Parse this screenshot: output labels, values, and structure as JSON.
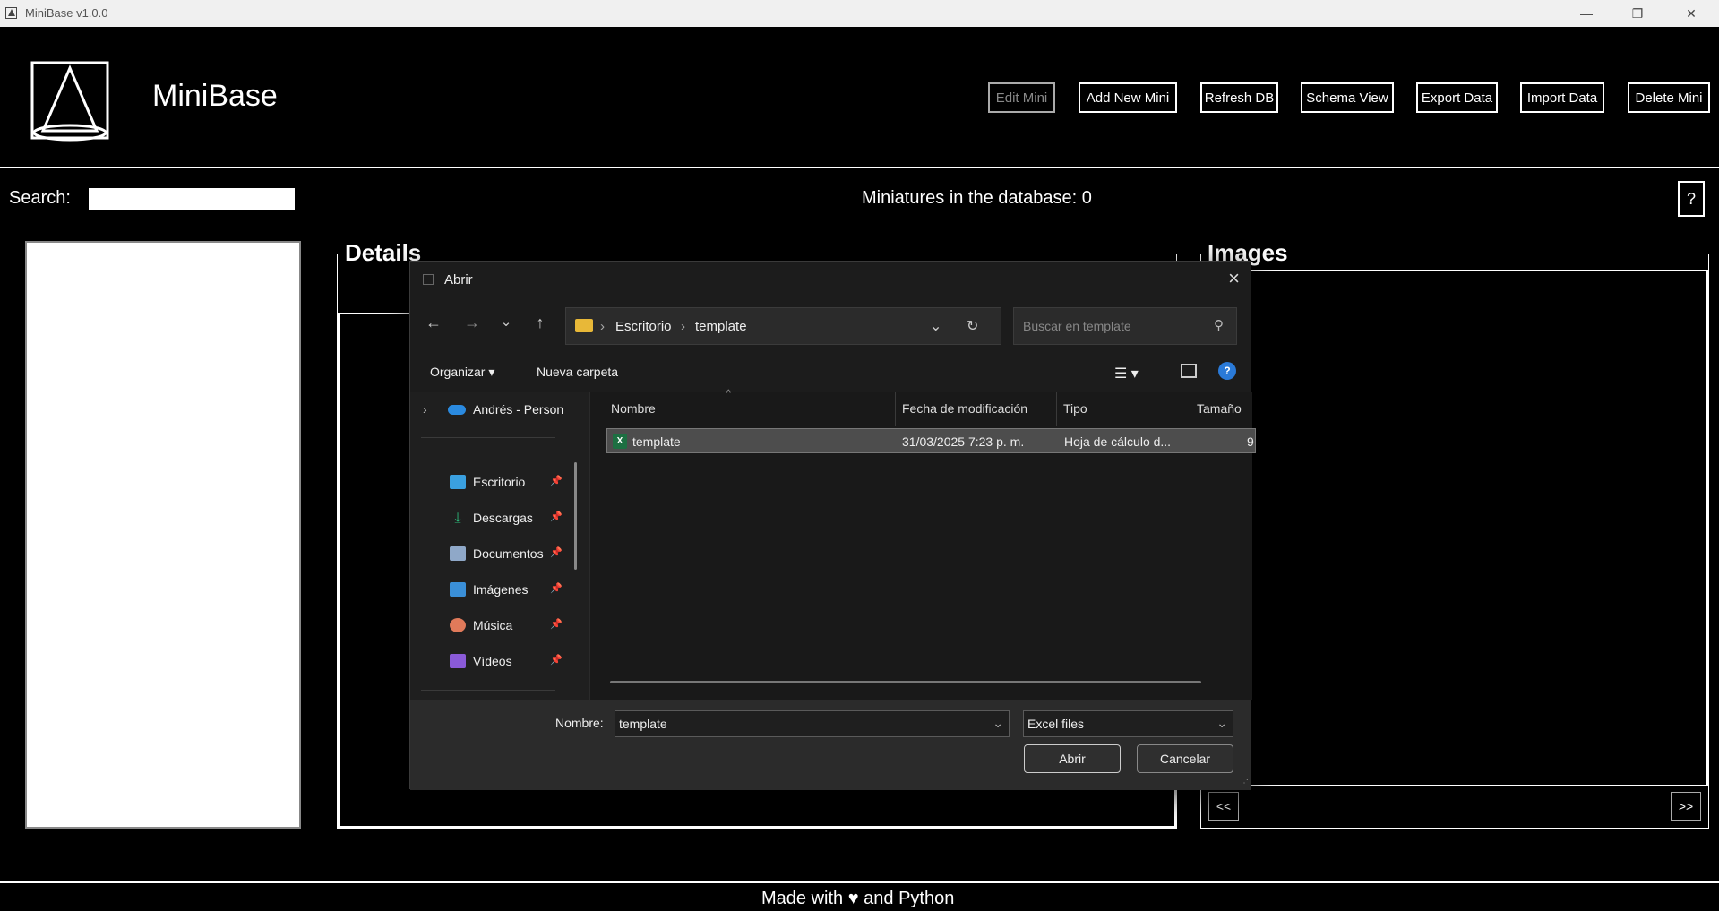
{
  "window": {
    "title": "MiniBase v1.0.0",
    "min": "—",
    "max": "❐",
    "close": "✕"
  },
  "header": {
    "brand": "MiniBase",
    "buttons": [
      "Edit Mini",
      "Add New Mini",
      "Refresh DB",
      "Schema View",
      "Export Data",
      "Import Data",
      "Delete Mini"
    ]
  },
  "search": {
    "label": "Search:",
    "value": ""
  },
  "db_count": "Miniatures in the database: 0",
  "help": "?",
  "details": {
    "title": "Details"
  },
  "images": {
    "title": "Images",
    "prev": "<<",
    "next": ">>"
  },
  "footer": "Made with ♥ and Python",
  "dialog": {
    "title": "Abrir",
    "nav": {
      "back": "←",
      "forward": "→",
      "recent": "⌄",
      "up": "↑"
    },
    "path": [
      "Escritorio",
      "template"
    ],
    "search_placeholder": "Buscar en template",
    "toolbar": {
      "organize": "Organizar ▾",
      "new_folder": "Nueva carpeta"
    },
    "sidebar": {
      "cloud": "Andrés - Person",
      "items": [
        {
          "label": "Escritorio",
          "color": "#3aa0e0"
        },
        {
          "label": "Descargas",
          "color": "#2db87a"
        },
        {
          "label": "Documentos",
          "color": "#8fa8c8"
        },
        {
          "label": "Imágenes",
          "color": "#3a8fd8"
        },
        {
          "label": "Música",
          "color": "#e07a5a"
        },
        {
          "label": "Vídeos",
          "color": "#8a5ad8"
        }
      ]
    },
    "columns": [
      "Nombre",
      "Fecha de modificación",
      "Tipo",
      "Tamaño"
    ],
    "files": [
      {
        "name": "template",
        "modified": "31/03/2025 7:23 p. m.",
        "type": "Hoja de cálculo d...",
        "size": "9"
      }
    ],
    "filename_label": "Nombre:",
    "filename_value": "template",
    "filter": "Excel files",
    "open": "Abrir",
    "cancel": "Cancelar"
  }
}
